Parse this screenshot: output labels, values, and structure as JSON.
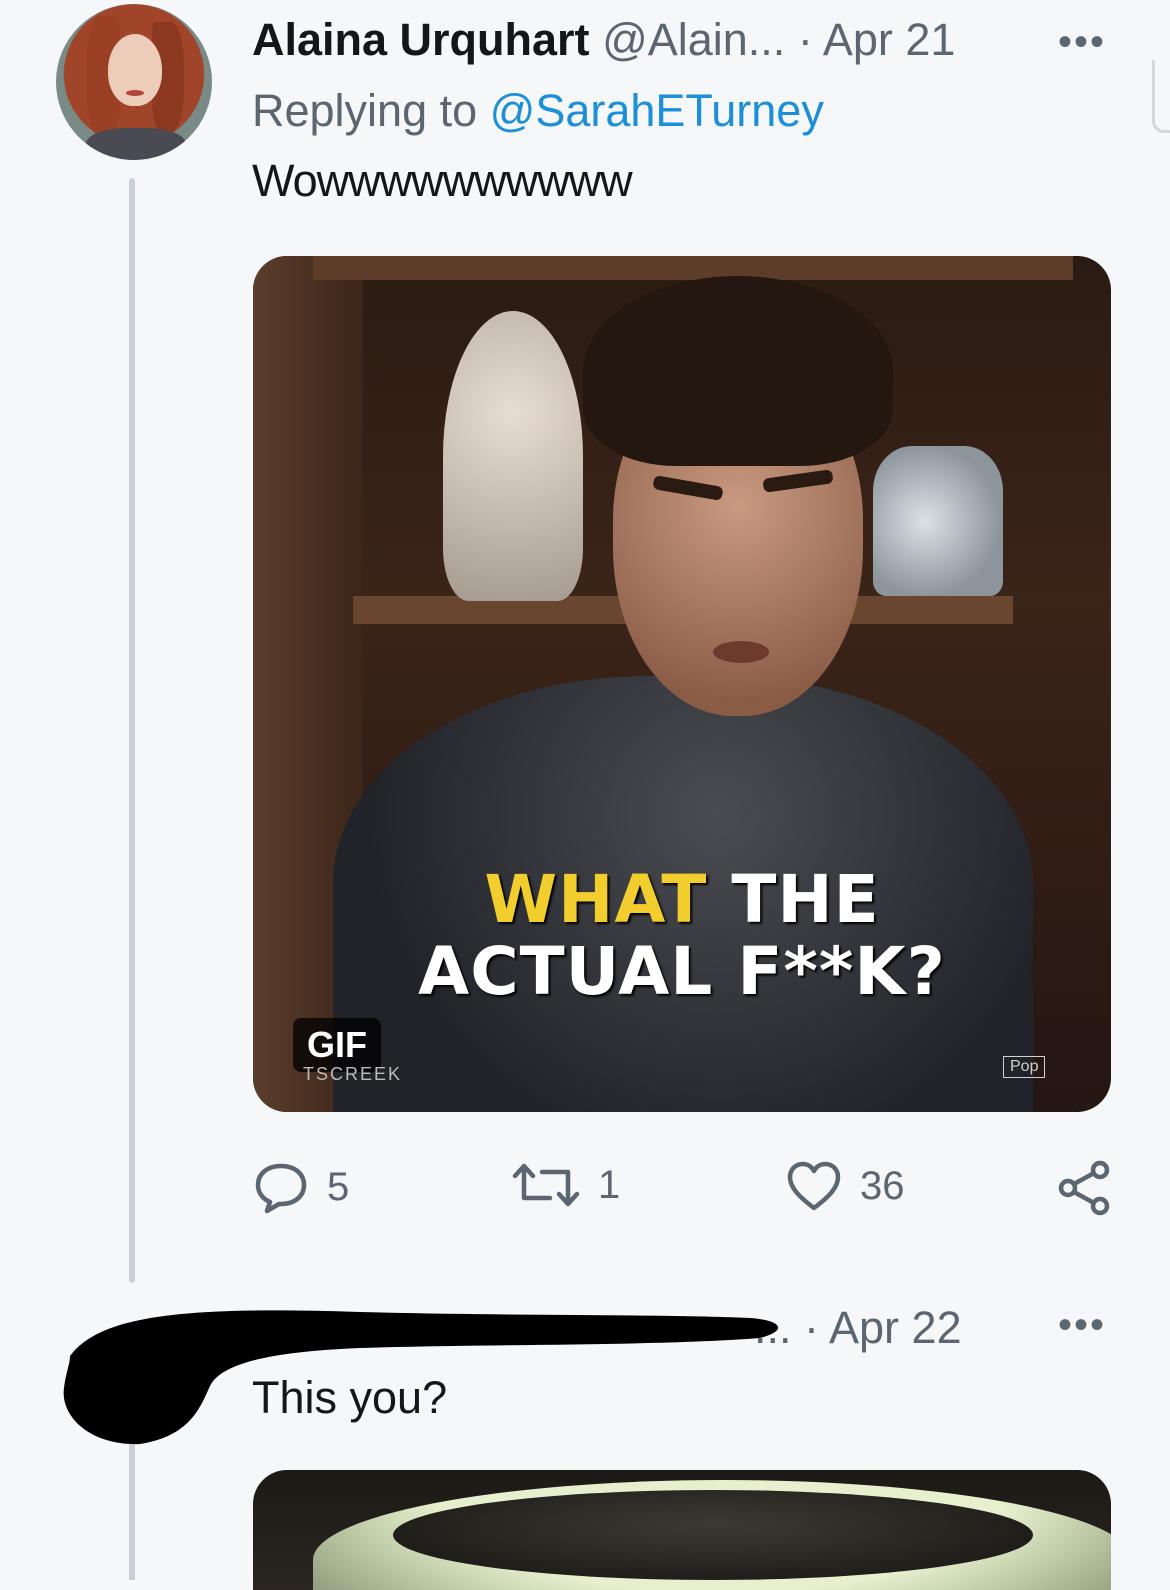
{
  "tweet1": {
    "name": "Alaina Urquhart",
    "handle": "@Alain...",
    "date": "· Apr 21",
    "replying_prefix": "Replying to",
    "replying_handle": "@SarahETurney",
    "text": "Wowwwwwwwwww",
    "media": {
      "caption_line1_highlight": "WHAT",
      "caption_line1_rest": " THE",
      "caption_line2": "ACTUAL F**K?",
      "badge": "GIF",
      "watermark_left": "TSCREEK",
      "watermark_right": "Pop"
    },
    "actions": {
      "replies": "5",
      "retweets": "1",
      "likes": "36"
    }
  },
  "tweet2": {
    "date_suffix": "... · Apr 22",
    "text": "This you?"
  },
  "icons": {
    "more": "more-horizontal-icon",
    "reply": "reply-bubble-icon",
    "retweet": "retweet-icon",
    "like": "heart-icon",
    "share": "share-icon"
  },
  "colors": {
    "link": "#1d8fd8",
    "muted": "#5b6670",
    "caption_highlight": "#f2cd2e"
  }
}
